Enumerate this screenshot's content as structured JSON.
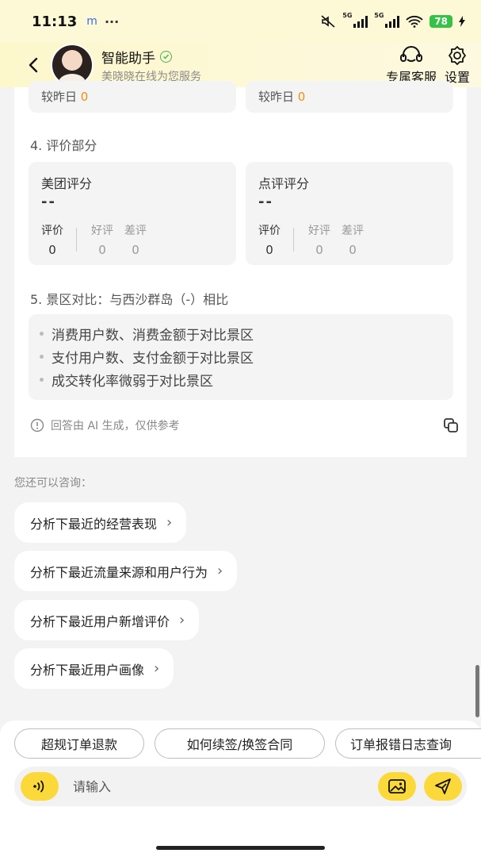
{
  "status_bar": {
    "time": "11:13",
    "app_icons": "m",
    "dots": "···",
    "net1": "5G",
    "net2": "5G",
    "battery": "78"
  },
  "header": {
    "assistant_name": "智能助手",
    "subtitle": "美晓晓在线为您服务",
    "service_label": "专属客服",
    "settings_label": "设置"
  },
  "report": {
    "prev_cards": [
      {
        "label": "较昨日",
        "value": "0"
      },
      {
        "label": "较昨日",
        "value": "0"
      }
    ],
    "section4_title": "4. 评价部分",
    "ratings": [
      {
        "name": "美团评分",
        "score": "--",
        "eval_label": "评价",
        "eval_value": "0",
        "good_label": "好评",
        "good_value": "0",
        "bad_label": "差评",
        "bad_value": "0"
      },
      {
        "name": "点评评分",
        "score": "--",
        "eval_label": "评价",
        "eval_value": "0",
        "good_label": "好评",
        "good_value": "0",
        "bad_label": "差评",
        "bad_value": "0"
      }
    ],
    "section5_title": "5. 景区对比：与西沙群岛（-）相比",
    "compare_items": [
      "消费用户数、消费金额于对比景区",
      "支付用户数、支付金额于对比景区",
      "成交转化率微弱于对比景区"
    ],
    "disclaimer": "回答由 AI 生成，仅供参考"
  },
  "consult": {
    "label": "您还可以咨询：",
    "suggestions": [
      "分析下最近的经营表现",
      "分析下最近流量来源和用户行为",
      "分析下最近用户新增评价",
      "分析下最近用户画像"
    ]
  },
  "quick_chips": [
    "超规订单退款",
    "如何续签/换签合同",
    "订单报错日志查询"
  ],
  "input": {
    "placeholder": "请输入"
  },
  "colors": {
    "accent": "#fcd93a",
    "orange": "#f08d15",
    "verified": "#43b64f",
    "header_bg": "#fdf7cc"
  }
}
